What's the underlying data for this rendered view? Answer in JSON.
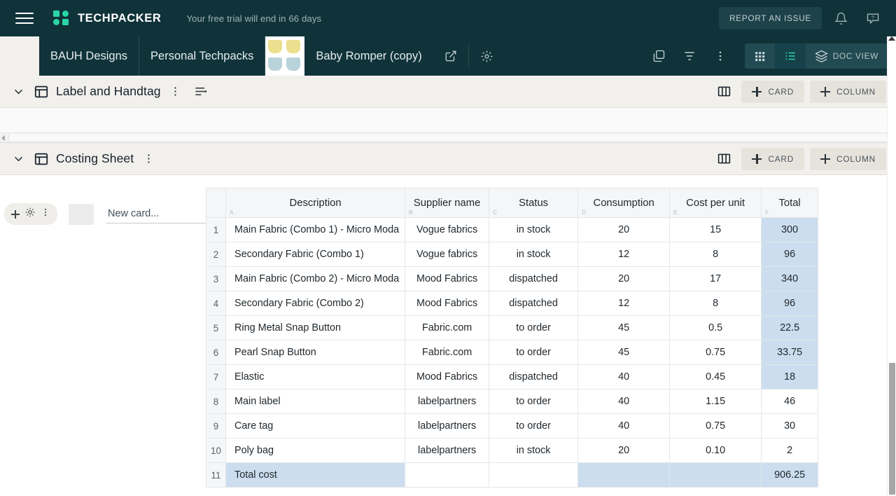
{
  "header": {
    "menu_icon": "hamburger-icon",
    "brand": "TECHPACKER",
    "trial_notice": "Your free trial will end in 66 days",
    "report_button": "REPORT AN ISSUE",
    "bell_icon": "bell-icon",
    "help_icon": "help-chat-icon",
    "background": "#10333a",
    "accent": "#2ad6a5"
  },
  "breadcrumb": {
    "items": [
      {
        "label": "BAUH Designs"
      },
      {
        "label": "Personal Techpacks"
      },
      {
        "label": "Baby Romper (copy)"
      }
    ],
    "open_external_icon": "external-link-icon",
    "settings_icon": "gear-icon"
  },
  "toolbar": {
    "duplicate_icon": "copy-layers-icon",
    "filter_icon": "filter-icon",
    "more_icon": "more-vertical-icon",
    "views": [
      {
        "name": "grid-view",
        "icon": "grid-icon",
        "active": false
      },
      {
        "name": "list-view",
        "icon": "list-icon",
        "active": true
      },
      {
        "name": "doc-view",
        "icon": "stack-icon",
        "label": "DOC VIEW",
        "active": false
      }
    ]
  },
  "sections": [
    {
      "title": "Label and Handtag",
      "collapse_icon": "chevron-down-icon",
      "board_icon": "board-icon",
      "more_icon": "more-vertical-icon",
      "list_icon": "list-lines-icon",
      "columns_icon": "columns-icon",
      "add_card_label": "CARD",
      "add_column_label": "COLUMN"
    },
    {
      "title": "Costing Sheet",
      "collapse_icon": "chevron-down-icon",
      "board_icon": "board-icon",
      "more_icon": "more-vertical-icon",
      "columns_icon": "columns-icon",
      "add_card_label": "CARD",
      "add_column_label": "COLUMN"
    }
  ],
  "card_rail": {
    "add_icon": "plus-icon",
    "settings_icon": "gear-icon",
    "more_icon": "more-vertical-icon",
    "new_card_placeholder": "New card...",
    "new_card_value": ""
  },
  "table": {
    "columns": [
      {
        "label": "Description",
        "key": "A"
      },
      {
        "label": "Supplier name",
        "key": "B"
      },
      {
        "label": "Status",
        "key": "C"
      },
      {
        "label": "Consumption",
        "key": "D"
      },
      {
        "label": "Cost per unit",
        "key": "E"
      },
      {
        "label": "Total",
        "key": "F"
      }
    ],
    "rows": [
      {
        "n": "1",
        "description": "Main Fabric (Combo 1) - Micro Moda",
        "supplier": "Vogue fabrics",
        "status": "in stock",
        "consumption": "20",
        "cost": "15",
        "total": "300",
        "total_highlight": true
      },
      {
        "n": "2",
        "description": "Secondary Fabric (Combo 1)",
        "supplier": "Vogue fabrics",
        "status": "in stock",
        "consumption": "12",
        "cost": "8",
        "total": "96",
        "total_highlight": true
      },
      {
        "n": "3",
        "description": "Main Fabric (Combo 2) - Micro Moda",
        "supplier": "Mood Fabrics",
        "status": "dispatched",
        "consumption": "20",
        "cost": "17",
        "total": "340",
        "total_highlight": true
      },
      {
        "n": "4",
        "description": "Secondary Fabric (Combo 2)",
        "supplier": "Mood Fabrics",
        "status": "dispatched",
        "consumption": "12",
        "cost": "8",
        "total": "96",
        "total_highlight": true
      },
      {
        "n": "5",
        "description": "Ring Metal Snap Button",
        "supplier": "Fabric.com",
        "status": "to order",
        "consumption": "45",
        "cost": "0.5",
        "total": "22.5",
        "total_highlight": true
      },
      {
        "n": "6",
        "description": "Pearl Snap Button",
        "supplier": "Fabric.com",
        "status": "to order",
        "consumption": "45",
        "cost": "0.75",
        "total": "33.75",
        "total_highlight": true
      },
      {
        "n": "7",
        "description": "Elastic",
        "supplier": "Mood Fabrics",
        "status": "dispatched",
        "consumption": "40",
        "cost": "0.45",
        "total": "18",
        "total_highlight": true
      },
      {
        "n": "8",
        "description": "Main label",
        "supplier": "labelpartners",
        "status": "to order",
        "consumption": "40",
        "cost": "1.15",
        "total": "46",
        "total_highlight": false
      },
      {
        "n": "9",
        "description": "Care tag",
        "supplier": "labelpartners",
        "status": "to order",
        "consumption": "40",
        "cost": "0.75",
        "total": "30",
        "total_highlight": false
      },
      {
        "n": "10",
        "description": "Poly bag",
        "supplier": "labelpartners",
        "status": "in stock",
        "consumption": "20",
        "cost": "0.10",
        "total": "2",
        "total_highlight": false
      },
      {
        "n": "11",
        "description": "Total cost",
        "supplier": "",
        "status": "",
        "consumption": "",
        "cost": "",
        "total": "906.25",
        "total_highlight": true,
        "is_total_row": true
      }
    ],
    "highlight_color": "#cbddee"
  }
}
